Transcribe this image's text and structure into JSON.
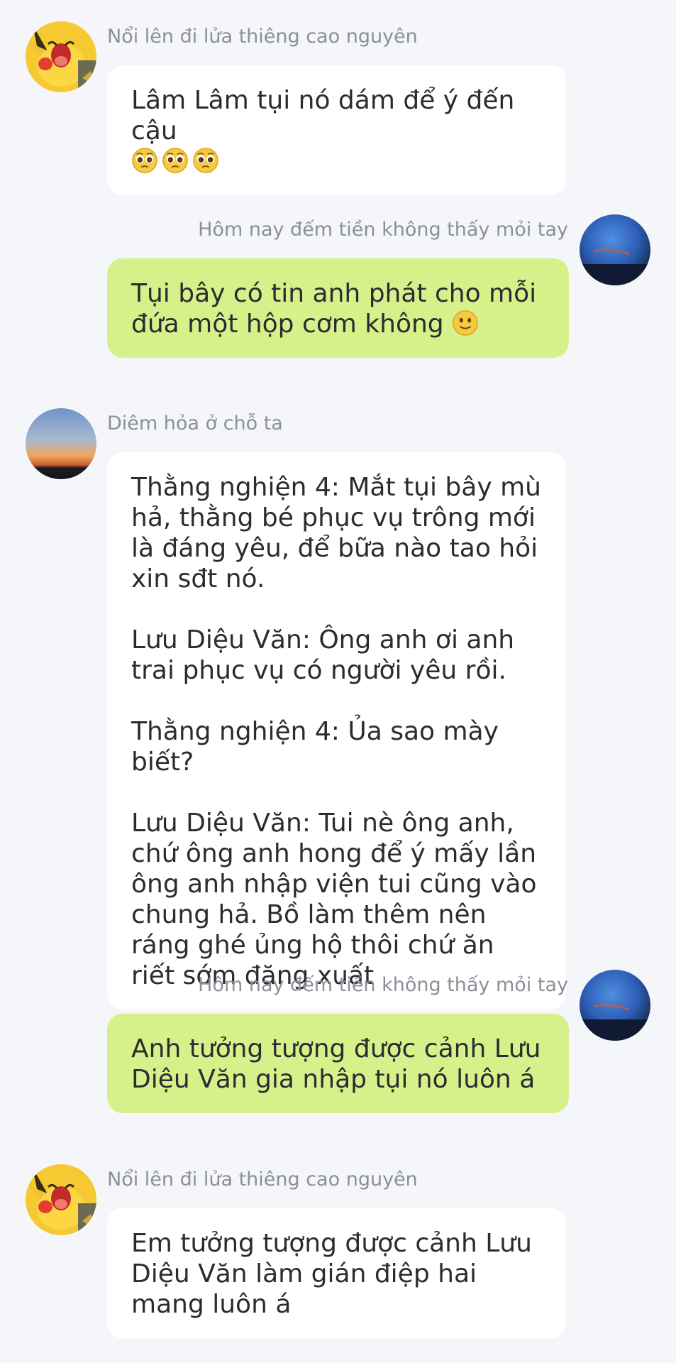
{
  "messages": [
    {
      "direction": "incoming",
      "sender": "Nổi lên đi lửa thiêng cao nguyên",
      "avatar_icon": "pikachu-avatar-icon",
      "text": "Lâm Lâm tụi nó dám để ý đến cậu",
      "trailing_emojis": [
        "pleading-face-icon",
        "pleading-face-icon",
        "pleading-face-icon"
      ]
    },
    {
      "direction": "outgoing",
      "sender": "Hôm nay đếm tiền không thấy mỏi tay",
      "avatar_icon": "blue-sky-avatar-icon",
      "text": "Tụi bây có tin anh phát cho mỗi đứa một hộp cơm không",
      "trailing_emojis": [
        "slightly-smiling-face-icon"
      ]
    },
    {
      "direction": "incoming",
      "sender": "Diêm hỏa ở chỗ ta",
      "avatar_icon": "sunset-avatar-icon",
      "paragraphs": [
        "Thằng nghiện 4: Mắt tụi bây mù hả, thằng bé phục vụ trông mới là đáng yêu, để bữa nào tao hỏi xin sđt nó.",
        "Lưu Diệu Văn: Ông anh ơi anh trai phục vụ có người yêu rồi.",
        "Thằng nghiện 4: Ủa sao mày biết?",
        "Lưu Diệu Văn: Tui nè ông anh, chứ ông anh hong để ý mấy lần ông anh nhập viện tui cũng vào chung hả. Bồ làm thêm nên ráng ghé ủng hộ thôi chứ ăn riết sớm đăng xuất"
      ]
    },
    {
      "direction": "outgoing",
      "sender": "Hôm nay đếm tiền không thấy mỏi tay",
      "avatar_icon": "blue-sky-avatar-icon",
      "text": "Anh tưởng tượng được cảnh Lưu Diệu Văn gia nhập tụi nó luôn á"
    },
    {
      "direction": "incoming",
      "sender": "Nổi lên đi lửa thiêng cao nguyên",
      "avatar_icon": "pikachu-avatar-icon",
      "text": "Em tưởng tượng được cảnh Lưu Diệu Văn làm gián điệp hai mang luôn á"
    }
  ],
  "colors": {
    "background": "#f4f6f9",
    "incoming_bubble": "#ffffff",
    "outgoing_bubble": "#d7f18a",
    "sender_name": "#8b8f97",
    "message_text": "#2a2c31"
  }
}
